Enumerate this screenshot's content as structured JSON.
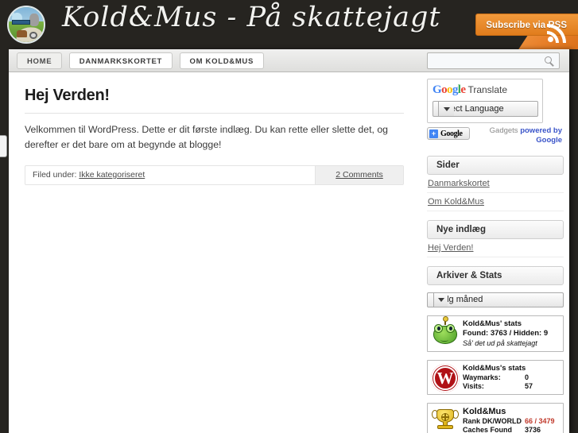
{
  "header": {
    "site_title": "Kold&Mus - På skattejagt",
    "logo_icon": "site-logo-icon",
    "rss": {
      "label": "Subscribe via RSS",
      "icon": "rss-icon",
      "color": "#e8802a"
    }
  },
  "nav": {
    "items": [
      {
        "label": "HOME",
        "active": true
      },
      {
        "label": "DANMARKSKORTET",
        "active": false
      },
      {
        "label": "OM KOLD&MUS",
        "active": false
      }
    ]
  },
  "search": {
    "value": "",
    "placeholder": "",
    "icon": "search-icon"
  },
  "post": {
    "title": "Hej Verden!",
    "body": "Velkommen til WordPress. Dette er dit første indlæg. Du kan rette eller slette det, og derefter er det bare om at begynde at blogge!",
    "filed_under_label": "Filed under:",
    "category": "Ikke kategoriseret",
    "comments": "2 Comments"
  },
  "sidebar": {
    "translate": {
      "logo_letters": [
        "G",
        "o",
        "o",
        "g",
        "l",
        "e"
      ],
      "logo_word": "Translate",
      "select_value": "Select Language",
      "add_button": "Google",
      "credit_prefix": "Gadgets ",
      "credit_link": "powered by Google"
    },
    "pages": {
      "heading": "Sider",
      "links": [
        "Danmarkskortet",
        "Om Kold&Mus"
      ]
    },
    "recent": {
      "heading": "Nye indlæg",
      "links": [
        "Hej Verden!"
      ]
    },
    "archives": {
      "heading": "Arkiver & Stats",
      "select_value": "Vælg måned"
    },
    "stats": [
      {
        "icon": "frog-icon",
        "title": "Kold&Mus' stats",
        "line": "Found: 3763 / Hidden: 9",
        "sub": "Så' det ud på skattejagt"
      },
      {
        "icon": "waymarking-w-icon",
        "title": "Kold&Mus's stats",
        "rows": [
          {
            "label": "Waymarks:",
            "value": "0"
          },
          {
            "label": "Visits:",
            "value": "57"
          }
        ]
      }
    ],
    "geocaching": {
      "icon": "trophy-icon",
      "title": "Kold&Mus",
      "rows": [
        {
          "label": "Rank DK/WORLD",
          "value": "66 / 3479",
          "red": true
        },
        {
          "label": "Caches Found",
          "value": "3736",
          "red": false
        }
      ]
    }
  }
}
